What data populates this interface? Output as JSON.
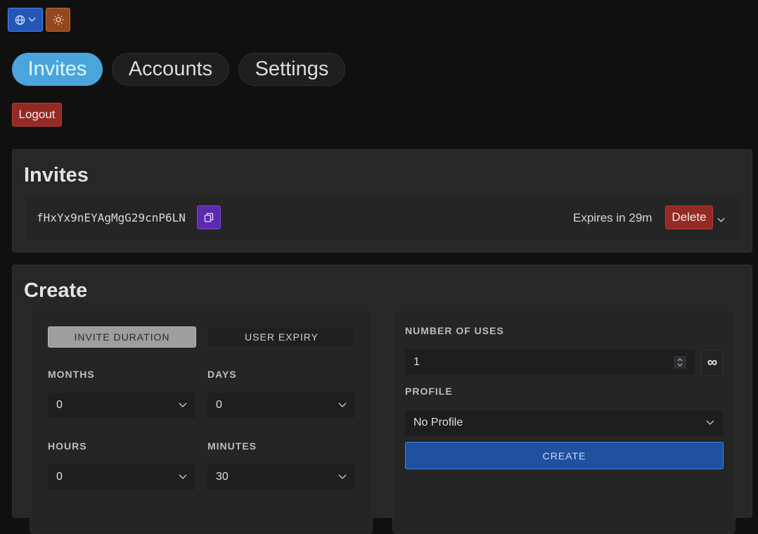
{
  "topbar": {
    "language_icon": "globe-icon",
    "theme_icon": "sun-icon"
  },
  "tabs": [
    {
      "label": "Invites",
      "active": true
    },
    {
      "label": "Accounts",
      "active": false
    },
    {
      "label": "Settings",
      "active": false
    }
  ],
  "logout_label": "Logout",
  "invites": {
    "title": "Invites",
    "items": [
      {
        "code": "fHxYx9nEYAgMgG29cnP6LN",
        "expiry": "Expires in 29m",
        "delete_label": "Delete"
      }
    ]
  },
  "create": {
    "title": "Create",
    "mode_tabs": [
      {
        "label": "INVITE DURATION",
        "active": true
      },
      {
        "label": "USER EXPIRY",
        "active": false
      }
    ],
    "fields": {
      "months": {
        "label": "MONTHS",
        "value": "0"
      },
      "days": {
        "label": "DAYS",
        "value": "0"
      },
      "hours": {
        "label": "HOURS",
        "value": "0"
      },
      "minutes": {
        "label": "MINUTES",
        "value": "30"
      }
    },
    "uses": {
      "label": "NUMBER OF USES",
      "value": "1",
      "infinite_symbol": "∞"
    },
    "profile": {
      "label": "PROFILE",
      "value": "No Profile"
    },
    "create_label": "CREATE"
  },
  "colors": {
    "accent": "#4aa5dc",
    "danger": "#942a24",
    "primary": "#2150a0",
    "copy": "#5b2ab0"
  }
}
